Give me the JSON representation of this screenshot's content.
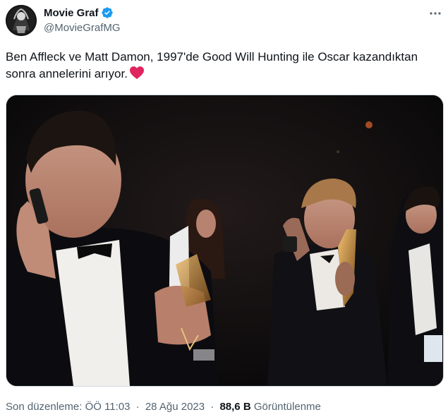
{
  "author": {
    "name": "Movie Graf",
    "handle": "@MovieGrafMG"
  },
  "tweet": {
    "text": "Ben Affleck ve Matt Damon, 1997'de Good Will Hunting ile Oscar kazandıktan sonra annelerini arıyor.",
    "emoji": "red-heart"
  },
  "meta": {
    "edited_label": "Son düzenleme: ÖÖ 11:03",
    "separator": "·",
    "date": "28 Ağu 2023",
    "views_count": "88,6 B",
    "views_label": "Görüntülenme"
  },
  "colors": {
    "text": "#0f1419",
    "secondary": "#536471",
    "verified": "#1d9bf0",
    "heart": "#e0245e"
  }
}
